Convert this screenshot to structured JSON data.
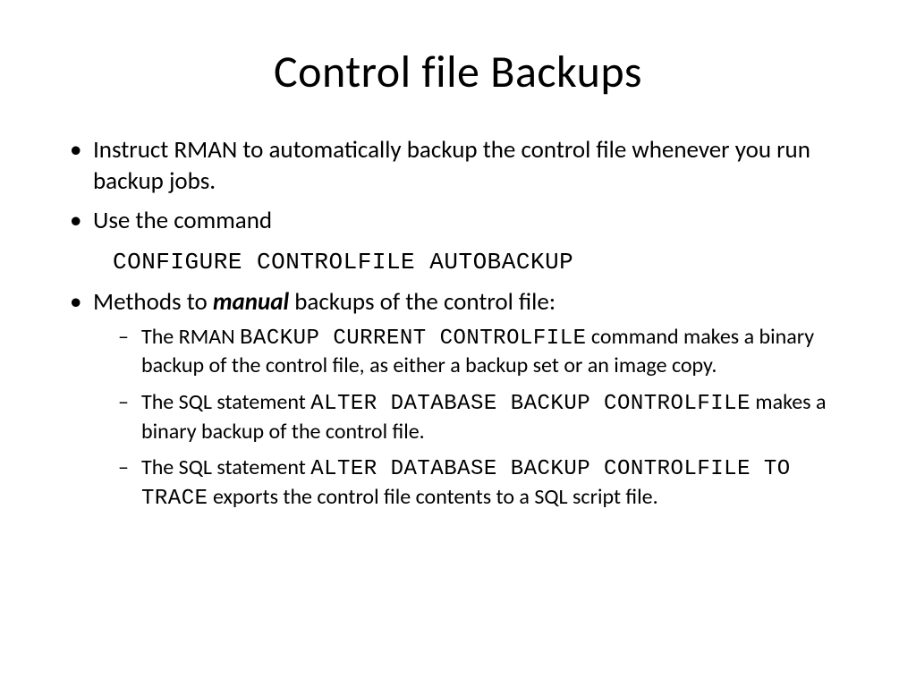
{
  "title": "Control file Backups",
  "bullets": {
    "b1": "Instruct RMAN to automatically backup the control file whenever you run backup jobs.",
    "b2": "Use the command",
    "cmd1": "CONFIGURE CONTROLFILE AUTOBACKUP",
    "b3_pre": "Methods to ",
    "b3_em": "manual",
    "b3_post": " backups of the control file:",
    "sub1_a": "The RMAN ",
    "sub1_code": "BACKUP CURRENT CONTROLFILE",
    "sub1_b": "  command makes a binary backup of the control file, as either a backup set or an image copy.",
    "sub2_a": "The SQL statement ",
    "sub2_code": "ALTER DATABASE BACKUP CONTROLFILE",
    "sub2_b": " makes a binary backup of the control file.",
    "sub3_a": "The SQL statement ",
    "sub3_code": "ALTER DATABASE BACKUP CONTROLFILE TO TRACE",
    "sub3_b": " exports the control file contents to a SQL script file."
  }
}
